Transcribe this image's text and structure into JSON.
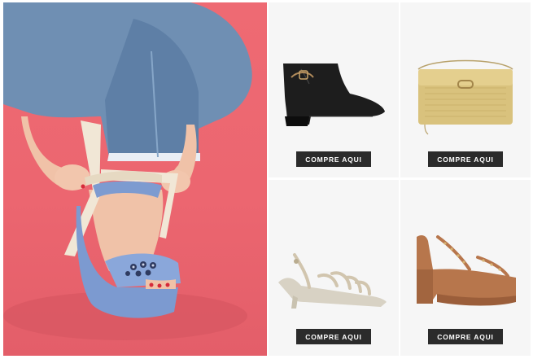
{
  "hero": {
    "image": "woman-tying-blue-platform-sandal-on-pink-background",
    "colors": {
      "background": "#ec6670",
      "denim": "#6d8fb5",
      "sandal": "#7d9bd0",
      "ribbon": "#f1e7d6"
    }
  },
  "products": [
    {
      "image": "black-leather-ankle-boot",
      "button_label": "COMPRE AQUI"
    },
    {
      "image": "gold-woven-clutch-bag",
      "button_label": "COMPRE AQUI"
    },
    {
      "image": "silver-strappy-kitten-heel-sandal",
      "button_label": "COMPRE AQUI"
    },
    {
      "image": "tan-platform-block-heel-sandal",
      "button_label": "COMPRE AQUI"
    }
  ],
  "colors": {
    "button_bg": "#2b2b2b",
    "button_text": "#ffffff",
    "cell_bg": "#f6f6f6"
  }
}
